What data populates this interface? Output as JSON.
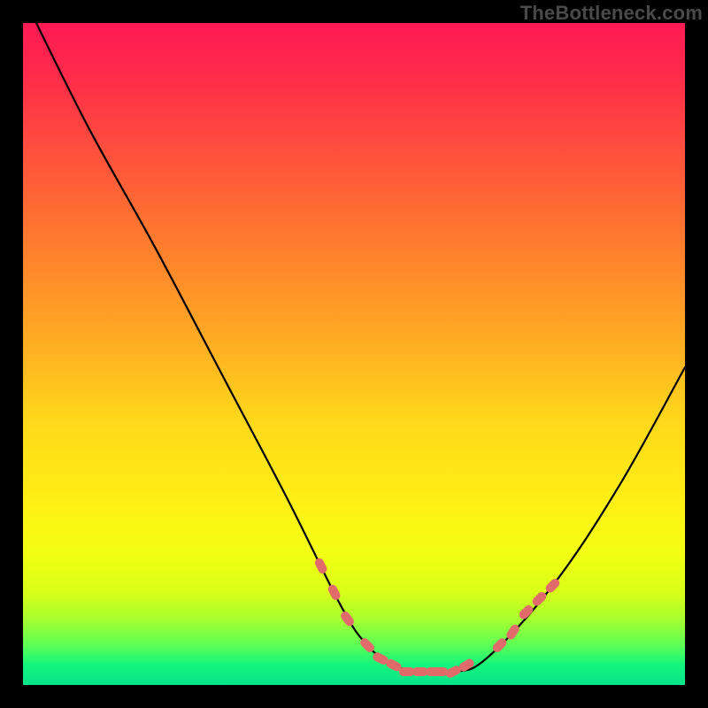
{
  "watermark": "TheBottleneck.com",
  "chart_data": {
    "type": "line",
    "title": "",
    "xlabel": "",
    "ylabel": "",
    "xlim": [
      0,
      100
    ],
    "ylim": [
      0,
      100
    ],
    "grid": false,
    "legend": false,
    "series": [
      {
        "name": "bottleneck-curve",
        "color": "#000000",
        "x": [
          2,
          10,
          20,
          30,
          40,
          48,
          52,
          56,
          60,
          65,
          70,
          80,
          90,
          100
        ],
        "y": [
          100,
          84,
          66,
          47,
          28,
          12,
          6,
          3,
          2,
          2,
          4,
          15,
          30,
          48
        ]
      },
      {
        "name": "highlight-markers",
        "color": "#E16A6A",
        "type": "scatter",
        "x": [
          45,
          47,
          49,
          52,
          54,
          56,
          58,
          60,
          62,
          63,
          65,
          67,
          72,
          74,
          76,
          78,
          80
        ],
        "y": [
          18,
          14,
          10,
          6,
          4,
          3,
          2,
          2,
          2,
          2,
          2,
          3,
          6,
          8,
          11,
          13,
          15
        ]
      }
    ],
    "background_gradient": {
      "direction": "vertical",
      "stops": [
        {
          "pos": 0,
          "color": "#ff1a55"
        },
        {
          "pos": 18,
          "color": "#ff4b3f"
        },
        {
          "pos": 38,
          "color": "#ff8b2a"
        },
        {
          "pos": 60,
          "color": "#ffd81a"
        },
        {
          "pos": 80,
          "color": "#f3ff12"
        },
        {
          "pos": 94,
          "color": "#5cff55"
        },
        {
          "pos": 100,
          "color": "#07e28a"
        }
      ]
    }
  }
}
